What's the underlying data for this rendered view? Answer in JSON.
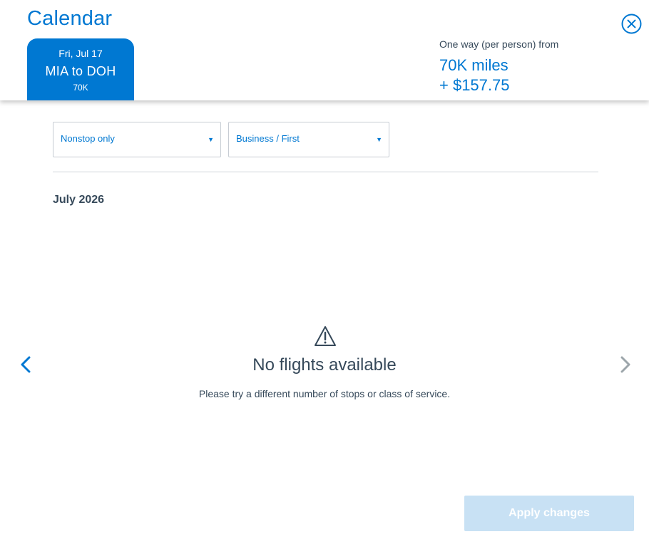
{
  "header": {
    "title": "Calendar",
    "close_icon": "close-circle-icon",
    "selected_date_tab": {
      "date": "Fri, Jul 17",
      "route": "MIA to DOH",
      "miles": "70K"
    },
    "fare": {
      "label": "One way (per person) from",
      "miles": "70K miles",
      "cash": "+ $157.75"
    }
  },
  "filters": {
    "stops": {
      "selected": "Nonstop only",
      "icon": "caret-down-icon"
    },
    "cabin": {
      "selected": "Business / First",
      "icon": "caret-down-icon"
    }
  },
  "calendar": {
    "month": "July 2026",
    "prev_icon": "chevron-left-icon",
    "next_icon": "chevron-right-icon"
  },
  "empty_state": {
    "icon": "warning-triangle-icon",
    "title": "No flights available",
    "message": "Please try a different number of stops or class of service."
  },
  "footer": {
    "apply_label": "Apply changes",
    "apply_disabled": true
  },
  "colors": {
    "accent": "#0078d2",
    "text": "#36495a",
    "disabled_button": "#c8e1f4",
    "border": "#c6ccd3",
    "nav_disabled": "#9da6ab"
  }
}
